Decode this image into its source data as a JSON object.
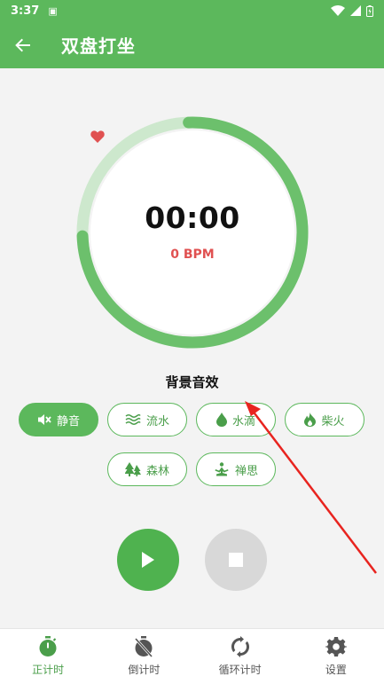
{
  "status_bar": {
    "time": "3:37"
  },
  "app_bar": {
    "title": "双盘打坐"
  },
  "timer": {
    "display": "00:00",
    "heart_rate": "0 BPM",
    "ring_progress": 0.75
  },
  "sound_section": {
    "title": "背景音效",
    "options": [
      {
        "label": "静音",
        "icon": "mute-icon",
        "selected": true
      },
      {
        "label": "流水",
        "icon": "water-waves-icon",
        "selected": false
      },
      {
        "label": "水滴",
        "icon": "water-drop-icon",
        "selected": false
      },
      {
        "label": "柴火",
        "icon": "fire-icon",
        "selected": false
      },
      {
        "label": "森林",
        "icon": "forest-icon",
        "selected": false
      },
      {
        "label": "禅思",
        "icon": "meditation-icon",
        "selected": false
      }
    ]
  },
  "bottom_nav": {
    "items": [
      {
        "label": "正计时",
        "icon": "stopwatch-icon",
        "active": true
      },
      {
        "label": "倒计时",
        "icon": "timer-off-icon",
        "active": false
      },
      {
        "label": "循环计时",
        "icon": "repeat-icon",
        "active": false
      },
      {
        "label": "设置",
        "icon": "gear-icon",
        "active": false
      }
    ]
  },
  "colors": {
    "primary": "#5cb85c",
    "heart": "#e05151",
    "ring_light": "#cde8cd",
    "ring_dark": "#6cc06c"
  }
}
